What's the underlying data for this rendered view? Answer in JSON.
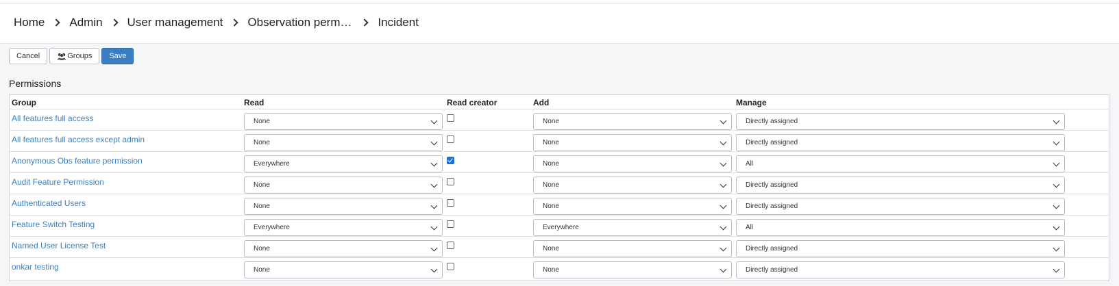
{
  "breadcrumb": {
    "items": [
      {
        "label": "Home"
      },
      {
        "label": "Admin"
      },
      {
        "label": "User management"
      },
      {
        "label": "Observation permissions"
      },
      {
        "label": "Incident"
      }
    ]
  },
  "toolbar": {
    "cancel_label": "Cancel",
    "groups_label": "Groups",
    "save_label": "Save",
    "primary_color": "#3b7fc0"
  },
  "permissions": {
    "title": "Permissions",
    "columns": {
      "group": "Group",
      "read": "Read",
      "read_creator": "Read creator",
      "add": "Add",
      "manage": "Manage"
    },
    "rows": [
      {
        "group": "All features full access",
        "read": "None",
        "read_creator": false,
        "add": "None",
        "manage": "Directly assigned"
      },
      {
        "group": "All features full access except admin",
        "read": "None",
        "read_creator": false,
        "add": "None",
        "manage": "Directly assigned"
      },
      {
        "group": "Anonymous Obs feature permission",
        "read": "Everywhere",
        "read_creator": true,
        "add": "None",
        "manage": "All"
      },
      {
        "group": "Audit Feature Permission",
        "read": "None",
        "read_creator": false,
        "add": "None",
        "manage": "Directly assigned"
      },
      {
        "group": "Authenticated Users",
        "read": "None",
        "read_creator": false,
        "add": "None",
        "manage": "Directly assigned"
      },
      {
        "group": "Feature Switch Testing",
        "read": "Everywhere",
        "read_creator": false,
        "add": "Everywhere",
        "manage": "All"
      },
      {
        "group": "Named User License Test",
        "read": "None",
        "read_creator": false,
        "add": "None",
        "manage": "Directly assigned"
      },
      {
        "group": "onkar testing",
        "read": "None",
        "read_creator": false,
        "add": "None",
        "manage": "Directly assigned"
      }
    ]
  }
}
